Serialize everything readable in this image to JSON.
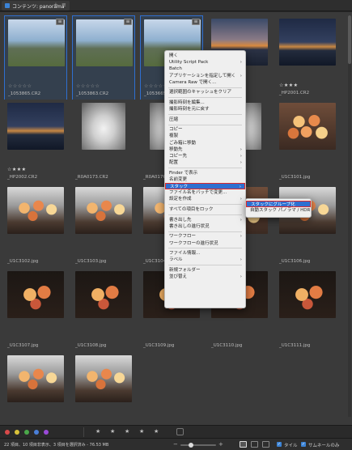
{
  "tabbar": {
    "tab_label": "コンテンツ: panorama",
    "add_glyph": "+",
    "menu_glyph": "≡"
  },
  "thumbnails": [
    {
      "filename": "_1053865.CR2",
      "stars": "☆☆☆☆☆",
      "thumb": "sky-day",
      "stack": true,
      "selected": true
    },
    {
      "filename": "_1053863.CR2",
      "stars": "☆☆☆☆☆",
      "thumb": "sky-day",
      "stack": true,
      "selected": true
    },
    {
      "filename": "_1053665.CR2",
      "stars": "☆☆☆☆☆",
      "thumb": "sky-day",
      "stack": true,
      "selected": true
    },
    {
      "filename": "",
      "stars": "",
      "thumb": "sky-dusk",
      "stack": false,
      "selected": false
    },
    {
      "filename": "_HP2001.CR2",
      "stars": "☆★★★",
      "thumb": "sky-night",
      "stack": false,
      "selected": false
    },
    {
      "filename": "_HP2002.CR2",
      "stars": "☆★★★",
      "thumb": "sky-night",
      "stack": false,
      "selected": false
    },
    {
      "filename": "_R0A0173.CR2",
      "stars": "",
      "thumb": "tunnel",
      "stack": false,
      "selected": false
    },
    {
      "filename": "_R0A0176.CR2",
      "stars": "",
      "thumb": "tunnel",
      "stack": false,
      "selected": false
    },
    {
      "filename": "",
      "stars": "",
      "thumb": "tunnel",
      "stack": false,
      "selected": false
    },
    {
      "filename": "_U1C3101.jpg",
      "stars": "",
      "thumb": "roses",
      "stack": false,
      "selected": false
    },
    {
      "filename": "_U1C3102.jpg",
      "stars": "",
      "thumb": "bowl",
      "stack": false,
      "selected": false
    },
    {
      "filename": "_U1C3103.jpg",
      "stars": "",
      "thumb": "bowl",
      "stack": false,
      "selected": false
    },
    {
      "filename": "_U1C3104.jpg",
      "stars": "",
      "thumb": "bowl",
      "stack": false,
      "selected": false
    },
    {
      "filename": "",
      "stars": "",
      "thumb": "roses",
      "stack": false,
      "selected": false
    },
    {
      "filename": "_U1C3106.jpg",
      "stars": "",
      "thumb": "bowl",
      "stack": false,
      "selected": false
    },
    {
      "filename": "_U1C3107.jpg",
      "stars": "",
      "thumb": "rose-dark",
      "stack": false,
      "selected": false
    },
    {
      "filename": "_U1C3108.jpg",
      "stars": "",
      "thumb": "rose-dark",
      "stack": false,
      "selected": false
    },
    {
      "filename": "_U1C3109.jpg",
      "stars": "",
      "thumb": "rose-dark",
      "stack": false,
      "selected": false
    },
    {
      "filename": "_U1C3110.jpg",
      "stars": "",
      "thumb": "rose-dark",
      "stack": false,
      "selected": false
    },
    {
      "filename": "_U1C3111.jpg",
      "stars": "",
      "thumb": "rose-dark",
      "stack": false,
      "selected": false
    },
    {
      "filename": "",
      "stars": "",
      "thumb": "bowl",
      "stack": false,
      "selected": false
    },
    {
      "filename": "",
      "stars": "",
      "thumb": "bowl",
      "stack": false,
      "selected": false
    }
  ],
  "context_menu": {
    "items": [
      {
        "label": "開く",
        "type": "item"
      },
      {
        "label": "Utility Script Pack",
        "type": "item",
        "arrow": true
      },
      {
        "label": "Batch",
        "type": "item"
      },
      {
        "label": "アプリケーションを指定して開く",
        "type": "item",
        "arrow": true
      },
      {
        "label": "Camera Raw で開く...",
        "type": "item"
      },
      {
        "type": "sep"
      },
      {
        "label": "選択範囲のキャッシュをクリア",
        "type": "item"
      },
      {
        "type": "sep"
      },
      {
        "label": "撮影時刻を編集...",
        "type": "item"
      },
      {
        "label": "撮影時刻を元に戻す",
        "type": "item"
      },
      {
        "type": "sep"
      },
      {
        "label": "圧縮",
        "type": "item"
      },
      {
        "type": "sep"
      },
      {
        "label": "コピー",
        "type": "item"
      },
      {
        "label": "複製",
        "type": "item"
      },
      {
        "label": "ごみ箱に移動",
        "type": "item"
      },
      {
        "label": "移動先",
        "type": "item",
        "arrow": true
      },
      {
        "label": "コピー先",
        "type": "item",
        "arrow": true
      },
      {
        "label": "配置",
        "type": "item",
        "arrow": true
      },
      {
        "type": "sep"
      },
      {
        "label": "Finder で表示",
        "type": "item"
      },
      {
        "label": "名前変更",
        "type": "item"
      },
      {
        "label": "スタック",
        "type": "item",
        "arrow": true,
        "highlight": true
      },
      {
        "label": "ファイル名をバッチで変更...",
        "type": "item"
      },
      {
        "label": "設定を作成",
        "type": "item",
        "arrow": true
      },
      {
        "type": "sep"
      },
      {
        "label": "すべての項目をロック",
        "type": "item"
      },
      {
        "type": "sep"
      },
      {
        "label": "書き出し先",
        "type": "item",
        "arrow": true
      },
      {
        "label": "書き出しの進行状況",
        "type": "item"
      },
      {
        "type": "sep"
      },
      {
        "label": "ワークフロー",
        "type": "item",
        "arrow": true
      },
      {
        "label": "ワークフローの進行状況",
        "type": "item"
      },
      {
        "type": "sep"
      },
      {
        "label": "ファイル情報...",
        "type": "item"
      },
      {
        "label": "ラベル",
        "type": "item",
        "arrow": true
      },
      {
        "type": "sep"
      },
      {
        "label": "新規フォルダー",
        "type": "item"
      },
      {
        "label": "並び替え",
        "type": "item",
        "arrow": true
      }
    ]
  },
  "submenu": {
    "group_label": "スタックにグループ化",
    "auto_stack_label": "自動スタック パノラマ / HDR"
  },
  "filterbar": {
    "colors": [
      "#d94a4a",
      "#d9c23a",
      "#4aa84a",
      "#4a7fd9",
      "#9a4ad9"
    ],
    "stars": [
      "★",
      "★",
      "★",
      "★",
      "★"
    ]
  },
  "statusbar": {
    "text": "22 項目、10 項目非表示、3 項目を選択済み - 76.53 MB",
    "zoom_minus": "−",
    "zoom_plus": "+",
    "zoom_level": 0.3,
    "tile_label": "タイル",
    "thumb_only_label": "サムネールのみ"
  }
}
